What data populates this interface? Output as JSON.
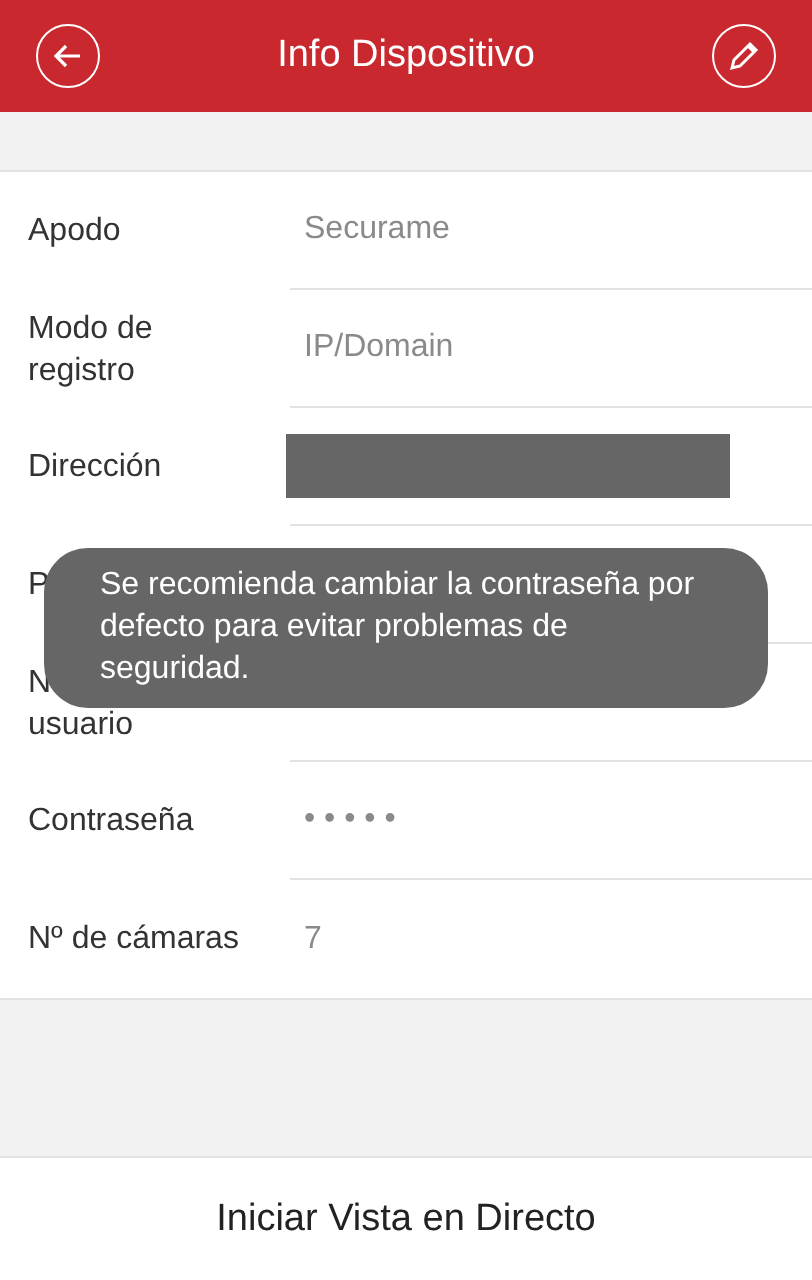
{
  "header": {
    "title": "Info Dispositivo"
  },
  "fields": [
    {
      "label": "Apodo",
      "value": "Securame",
      "kind": "text"
    },
    {
      "label": "Modo de\nregistro",
      "value": "IP/Domain",
      "kind": "text"
    },
    {
      "label": "Dirección",
      "kind": "redacted"
    },
    {
      "label": "P",
      "kind": "empty"
    },
    {
      "label": "N\nusuario",
      "kind": "empty"
    },
    {
      "label": "Contraseña",
      "value": "• • • • •",
      "kind": "text"
    },
    {
      "label": "Nº de cámaras",
      "value": "7",
      "kind": "text"
    }
  ],
  "toast": "Se recomienda cambiar la contraseña por defecto para evitar problemas de seguridad.",
  "footer_button": "Iniciar Vista en Directo"
}
